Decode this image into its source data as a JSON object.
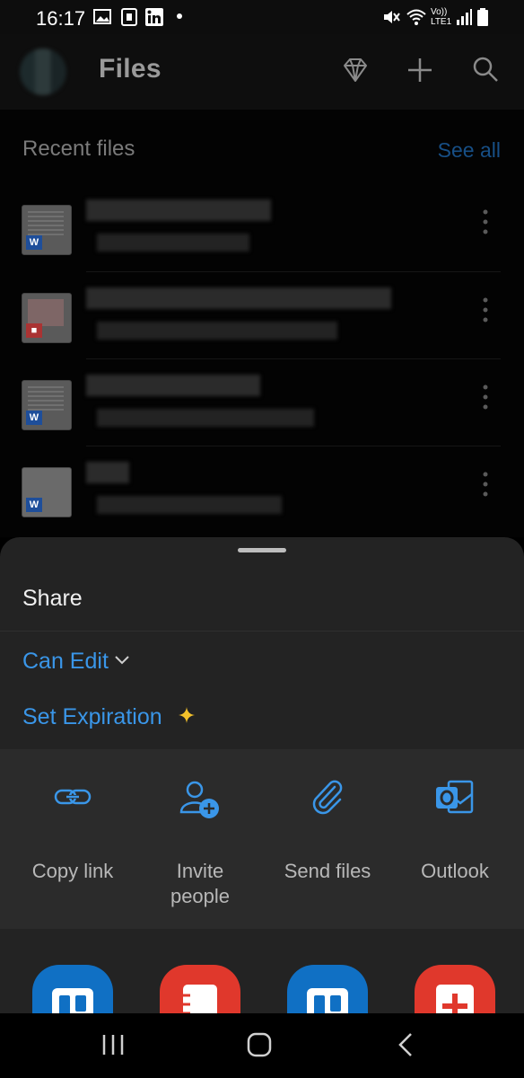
{
  "status_bar": {
    "time": "16:17",
    "network": "Vo)) LTE1"
  },
  "app_bar": {
    "title": "Files",
    "icons": [
      "premium-diamond-icon",
      "add-icon",
      "search-icon"
    ]
  },
  "recent": {
    "title": "Recent files",
    "see_all": "See all"
  },
  "sheet": {
    "title": "Share",
    "permission": "Can Edit",
    "expiration": "Set Expiration",
    "actions": [
      {
        "label": "Copy link",
        "icon": "link-icon"
      },
      {
        "label": "Invite people",
        "icon": "invite-people-icon"
      },
      {
        "label": "Send files",
        "icon": "paperclip-icon"
      },
      {
        "label": "Outlook",
        "icon": "outlook-icon"
      }
    ],
    "apps": [
      "trello-icon",
      "app-red-icon",
      "trello-icon",
      "app-red-plus-icon"
    ]
  },
  "colors": {
    "accent": "#3a96e8",
    "sparkle": "#f4c22b",
    "sheet": "#232323",
    "actions_bg": "#2b2b2b"
  }
}
